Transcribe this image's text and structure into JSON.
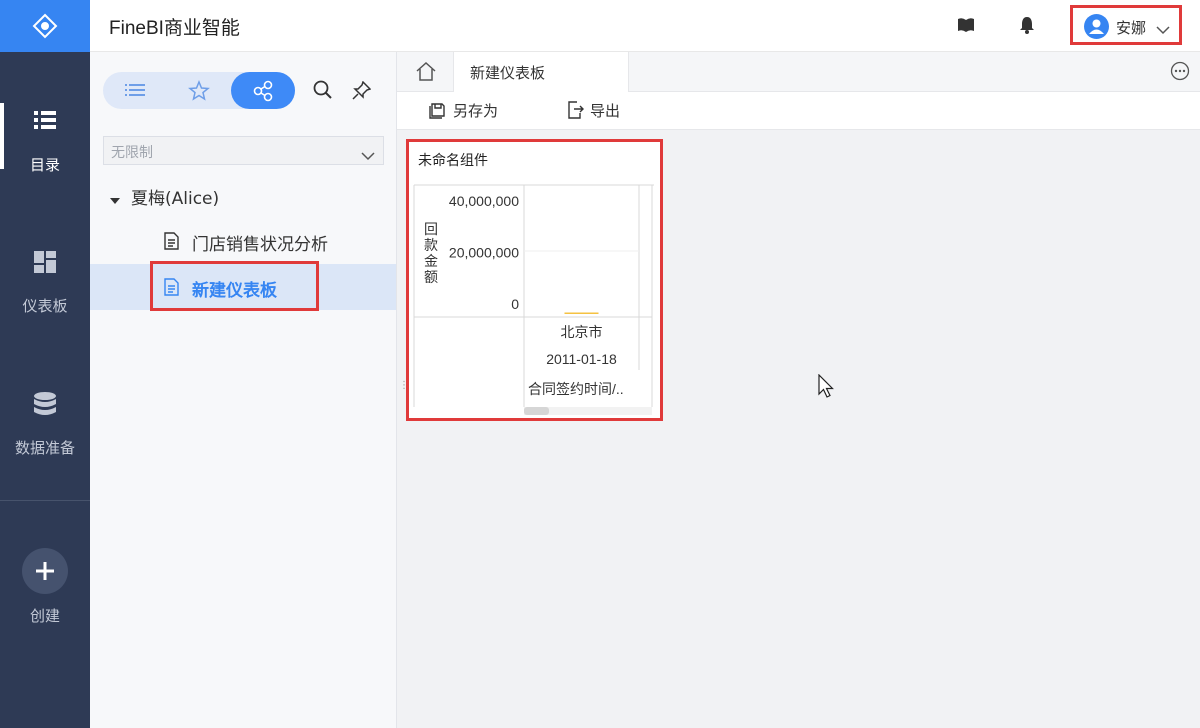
{
  "app": {
    "title": "FineBI商业智能"
  },
  "leftnav": {
    "items": [
      {
        "label": "目录",
        "icon": "list-icon",
        "active": true
      },
      {
        "label": "仪表板",
        "icon": "dashboard-icon",
        "active": false
      },
      {
        "label": "数据准备",
        "icon": "database-icon",
        "active": false
      }
    ],
    "create_label": "创建"
  },
  "topbar": {
    "user_name": "安娜"
  },
  "sidebar": {
    "filter_value": "无限制",
    "tree": {
      "folder_label": "夏梅(Alice)",
      "items": [
        {
          "label": "门店销售状况分析",
          "selected": false
        },
        {
          "label": "新建仪表板",
          "selected": true
        }
      ]
    }
  },
  "tabs": {
    "active_label": "新建仪表板"
  },
  "toolbar": {
    "save_as_label": "另存为",
    "export_label": "导出"
  },
  "widget": {
    "title": "未命名组件"
  },
  "chart_data": {
    "type": "bar",
    "ylabel": "回款金额",
    "yticks": [
      "40,000,000",
      "20,000,000",
      "0"
    ],
    "ylim": [
      0,
      40000000
    ],
    "categories_level1": [
      "北京市"
    ],
    "categories_level2": [
      "2011-01-18"
    ],
    "xlabel": "合同签约时间/..",
    "values": [
      0
    ],
    "bar_color": "#f5c242"
  },
  "colors": {
    "accent": "#3685f2",
    "highlight_border": "#e03a3a",
    "nav_bg": "#2e3a55"
  }
}
